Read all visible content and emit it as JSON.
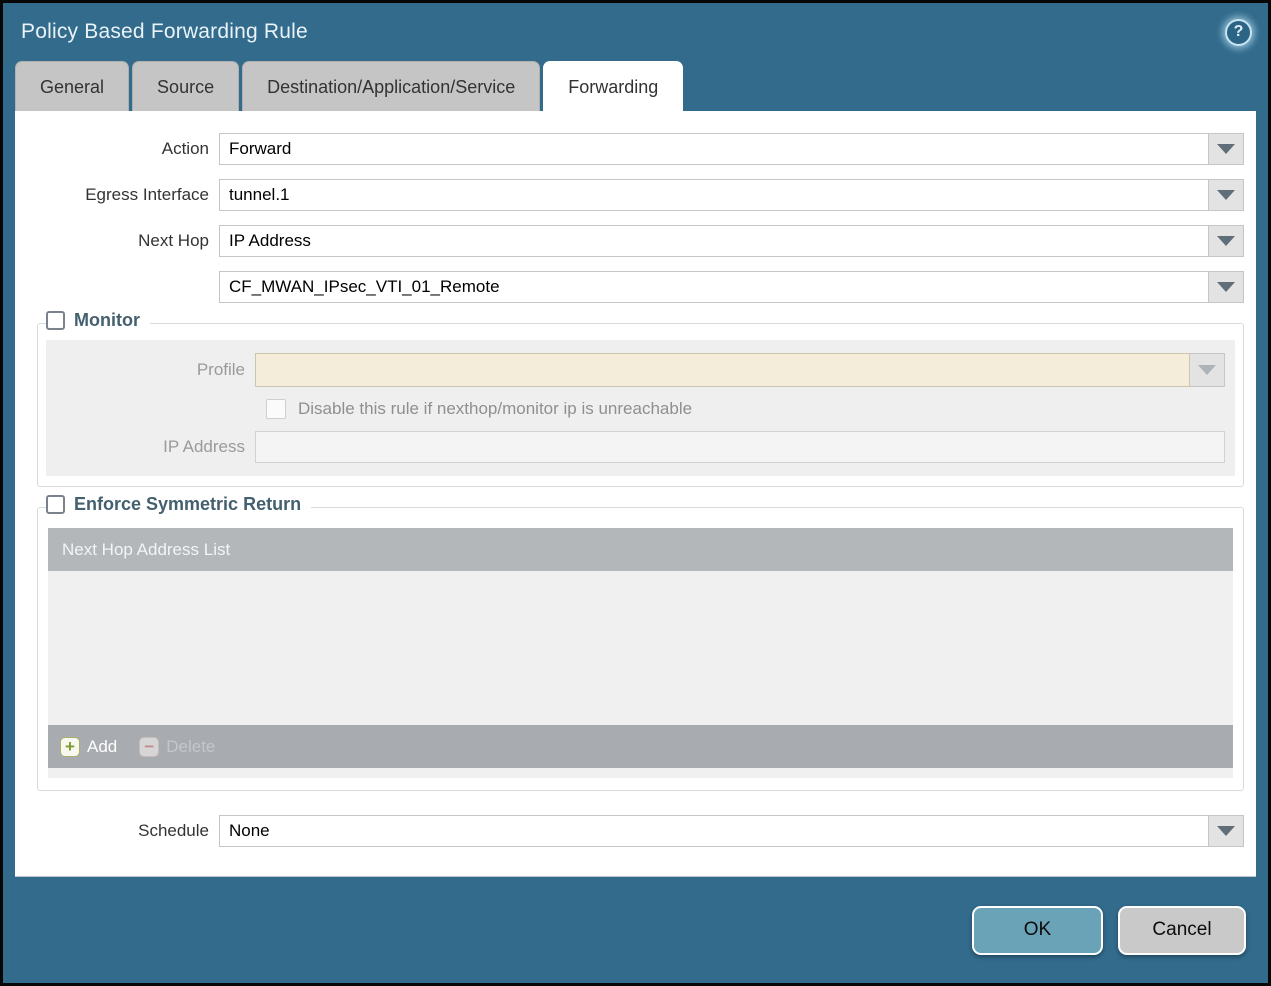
{
  "dialog": {
    "title": "Policy Based Forwarding Rule",
    "help_icon_glyph": "?"
  },
  "tabs": [
    {
      "label": "General",
      "active": false
    },
    {
      "label": "Source",
      "active": false
    },
    {
      "label": "Destination/Application/Service",
      "active": false
    },
    {
      "label": "Forwarding",
      "active": true
    }
  ],
  "form": {
    "action": {
      "label": "Action",
      "value": "Forward"
    },
    "egress_interface": {
      "label": "Egress Interface",
      "value": "tunnel.1"
    },
    "next_hop": {
      "label": "Next Hop",
      "value": "IP Address"
    },
    "next_hop_address": {
      "value": "CF_MWAN_IPsec_VTI_01_Remote"
    },
    "schedule": {
      "label": "Schedule",
      "value": "None"
    }
  },
  "monitor": {
    "label": "Monitor",
    "checked": false,
    "profile": {
      "label": "Profile",
      "value": ""
    },
    "disable_rule": {
      "label": "Disable this rule if nexthop/monitor ip is unreachable",
      "checked": false
    },
    "ip_address": {
      "label": "IP Address",
      "value": ""
    }
  },
  "enforce_symmetric_return": {
    "label": "Enforce Symmetric Return",
    "checked": false,
    "table": {
      "header": "Next Hop Address List",
      "rows": []
    },
    "add_label": "Add",
    "delete_label": "Delete"
  },
  "footer": {
    "ok_label": "OK",
    "cancel_label": "Cancel"
  },
  "colors": {
    "accent_teal": "#326b8c",
    "ok_button": "#6aa2b8",
    "disabled_field_beige": "#f3edda",
    "grid_header_gray": "#b3b7ba",
    "add_icon_green": "#7d9a2f",
    "delete_icon_red": "#cc7a7a"
  }
}
